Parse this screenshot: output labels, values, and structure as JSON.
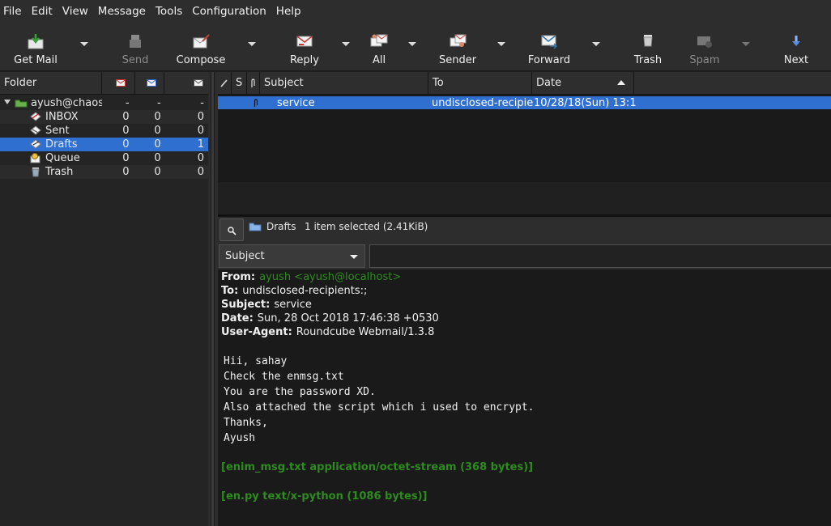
{
  "menu": [
    "File",
    "Edit",
    "View",
    "Message",
    "Tools",
    "Configuration",
    "Help"
  ],
  "toolbar": {
    "get_mail": "Get Mail",
    "send": "Send",
    "compose": "Compose",
    "reply": "Reply",
    "all": "All",
    "sender": "Sender",
    "forward": "Forward",
    "trash": "Trash",
    "spam": "Spam",
    "next": "Next"
  },
  "folder_header": {
    "folder": "Folder"
  },
  "folders": [
    {
      "name": "ayush@chaos",
      "c1": "-",
      "c2": "-",
      "c3": "-",
      "icon": "mailbox-icon"
    },
    {
      "name": "INBOX",
      "c1": "0",
      "c2": "0",
      "c3": "0",
      "icon": "inbox-icon"
    },
    {
      "name": "Sent",
      "c1": "0",
      "c2": "0",
      "c3": "0",
      "icon": "sent-icon"
    },
    {
      "name": "Drafts",
      "c1": "0",
      "c2": "0",
      "c3": "1",
      "icon": "drafts-icon"
    },
    {
      "name": "Queue",
      "c1": "0",
      "c2": "0",
      "c3": "0",
      "icon": "queue-icon"
    },
    {
      "name": "Trash",
      "c1": "0",
      "c2": "0",
      "c3": "0",
      "icon": "trash-folder-icon"
    }
  ],
  "list_header": {
    "s": "S",
    "subject": "Subject",
    "to": "To",
    "date": "Date"
  },
  "messages": [
    {
      "subject": "service",
      "to": "undisclosed-recipie",
      "date": "10/28/18(Sun) 13:1"
    }
  ],
  "status": {
    "folder": "Drafts",
    "summary": "1 item selected (2.41KiB)"
  },
  "quicksearch": {
    "type": "Subject",
    "value": ""
  },
  "message": {
    "from_label": "From:",
    "from": "ayush <ayush@localhost>",
    "to_label": "To:",
    "to": "undisclosed-recipients:;",
    "subject_label": "Subject:",
    "subject": "service",
    "date_label": "Date:",
    "date": "Sun, 28 Oct 2018 17:46:38 +0530",
    "ua_label": "User-Agent:",
    "user_agent": "Roundcube Webmail/1.3.8",
    "body": [
      "Hii, sahay",
      "Check the enmsg.txt",
      "You are the password XD.",
      "Also attached the script which i used to encrypt.",
      "Thanks,",
      "Ayush"
    ],
    "attachments": [
      "[enim_msg.txt  application/octet-stream (368 bytes)]",
      "[en.py  text/x-python (1086 bytes)]"
    ]
  },
  "colors": {
    "selection": "#2f6fd0",
    "link": "#2e8b1f",
    "from_link": "#2e8b1f"
  }
}
